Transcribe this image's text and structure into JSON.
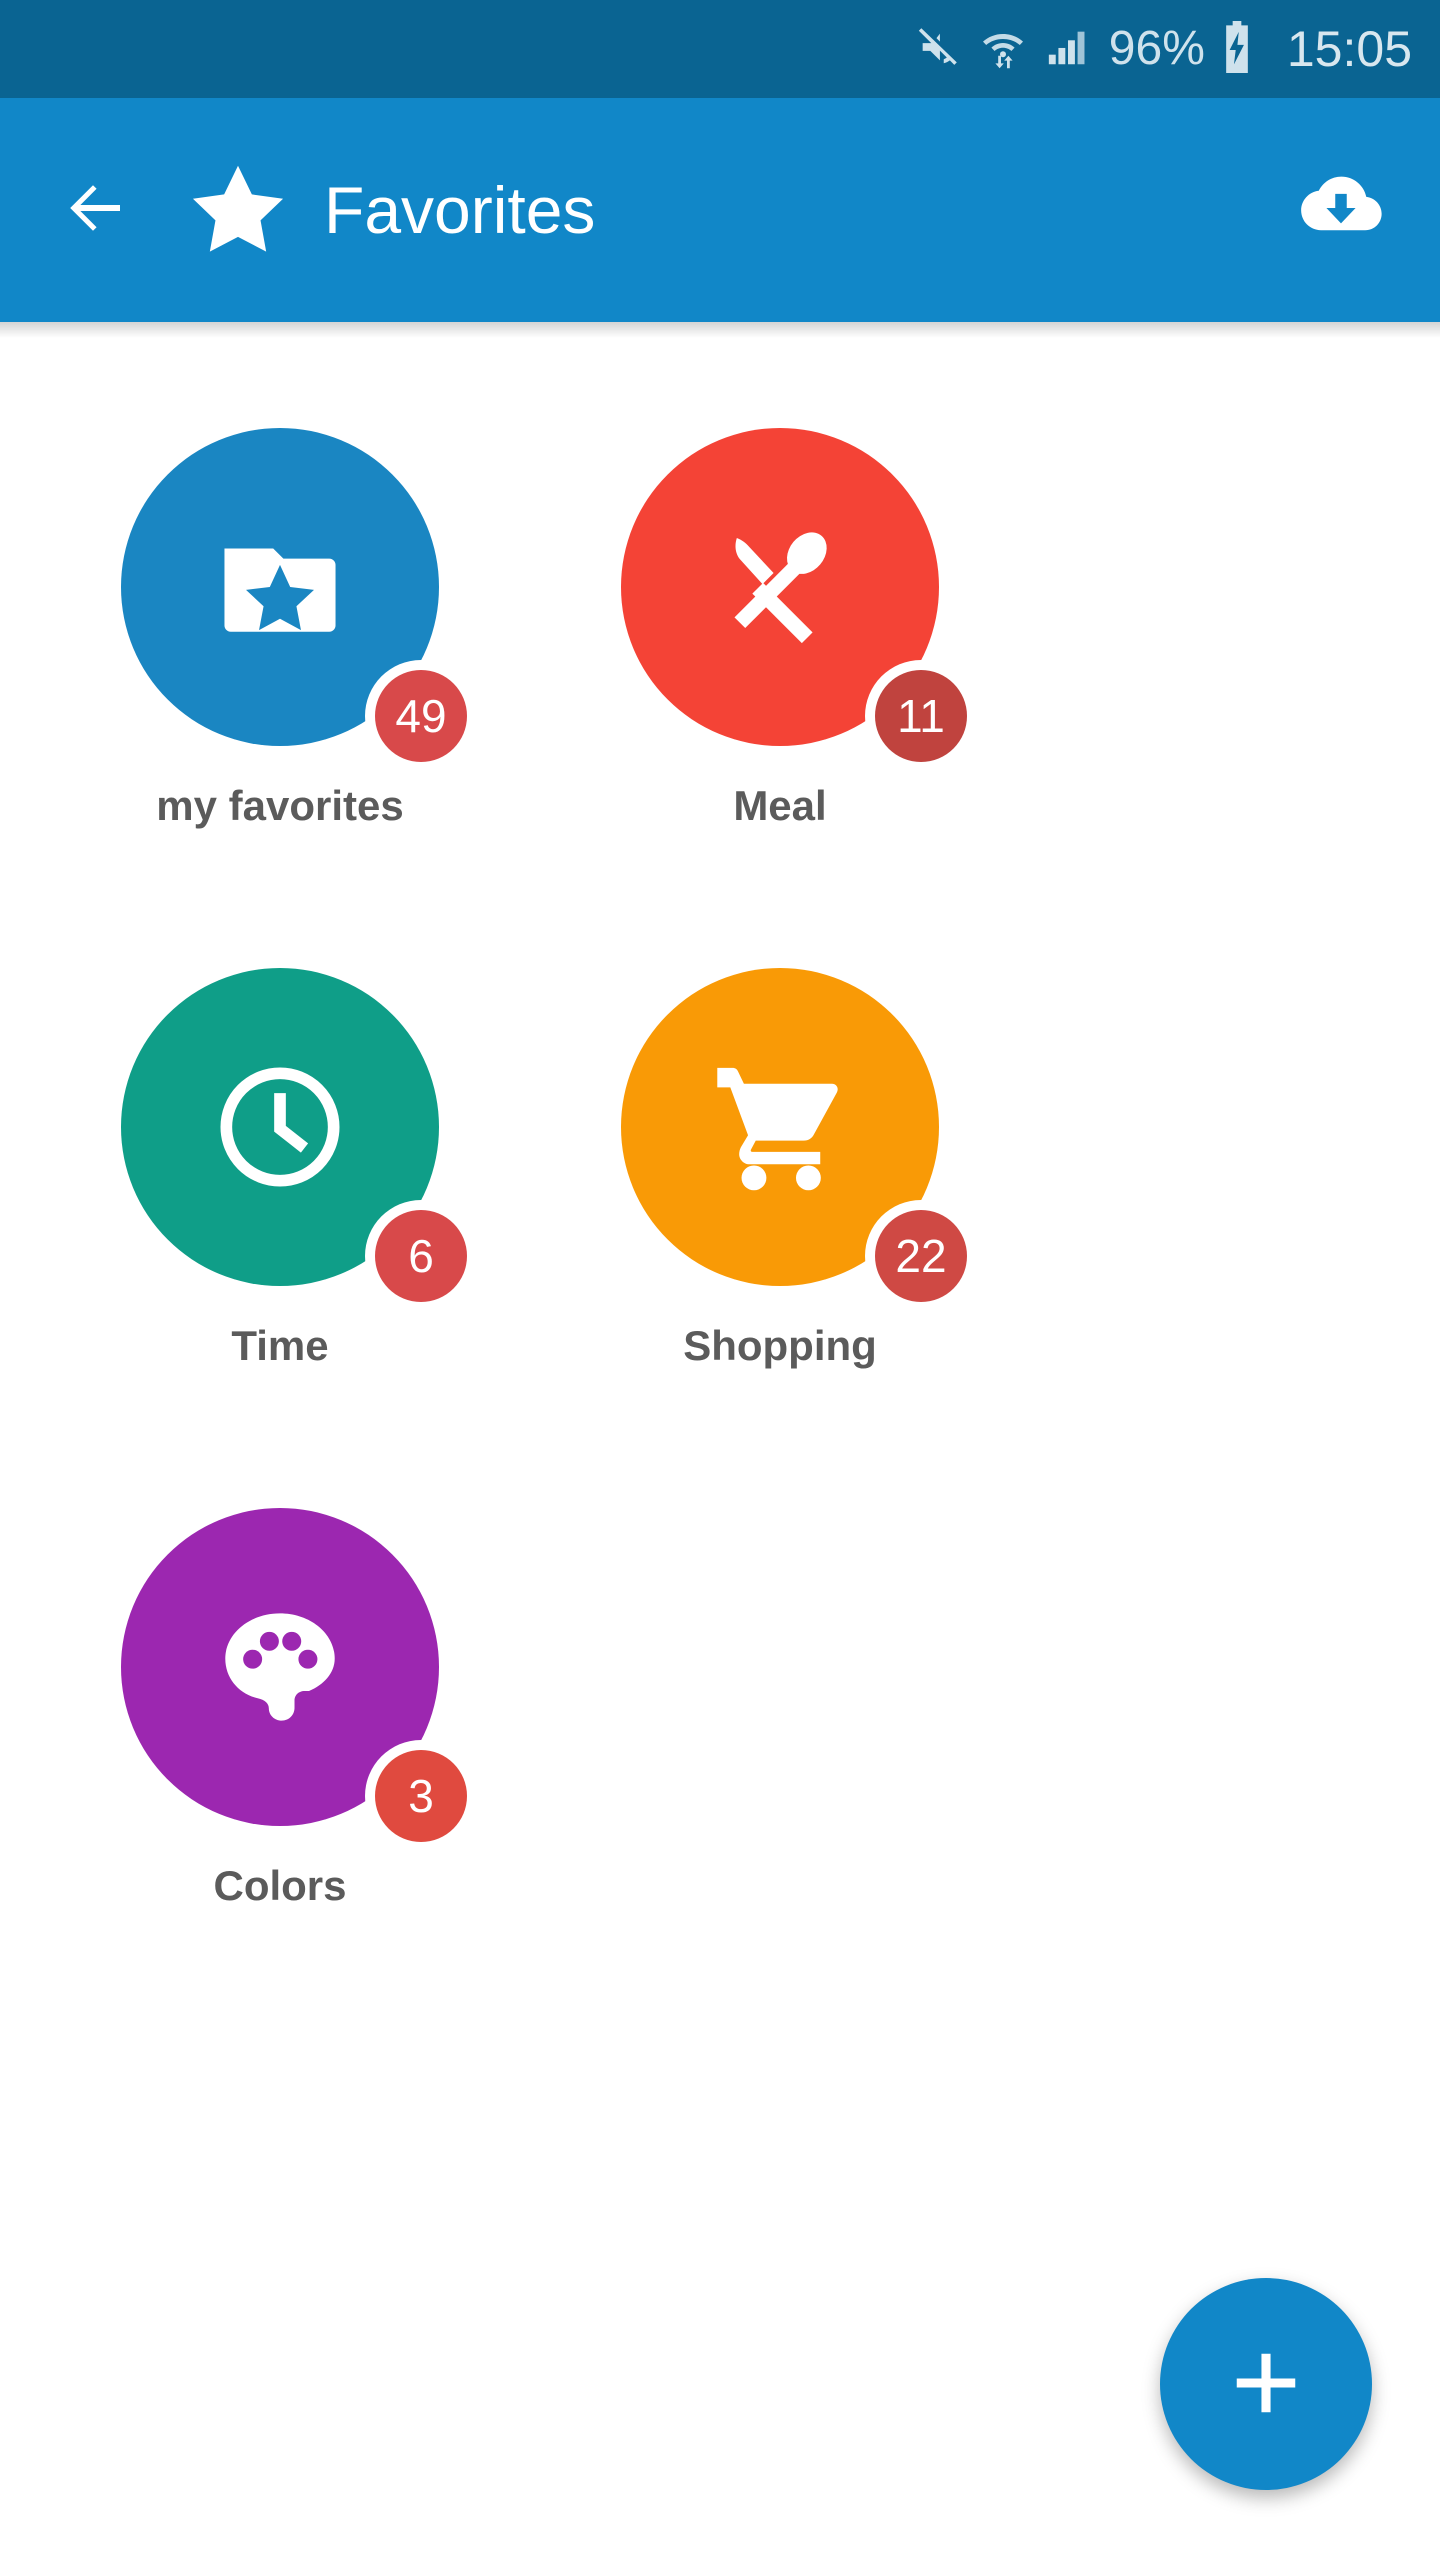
{
  "status_bar": {
    "background_color": "#0a6492",
    "text_color": "#cfe2ec",
    "mute_icon": "mute-icon",
    "wifi_icon": "wifi-transfer-icon",
    "signal_icon": "signal-bars-icon",
    "battery_percent": "96%",
    "battery_icon": "battery-charging-icon",
    "clock": "15:05"
  },
  "app_bar": {
    "background_color": "#1187c8",
    "back_icon": "back-arrow-icon",
    "star_icon": "star-icon",
    "title": "Favorites",
    "action_icon": "cloud-download-icon"
  },
  "grid": {
    "tiles": [
      {
        "label": "my favorites",
        "badge": "49",
        "color": "#1a86c2",
        "badge_color": "#d8494a",
        "icon": "folder-star-icon"
      },
      {
        "label": "Meal",
        "badge": "11",
        "color": "#f44336",
        "badge_color": "#c0433e",
        "icon": "knife-spoon-icon"
      },
      {
        "label": "Time",
        "badge": "6",
        "color": "#0f9e88",
        "badge_color": "#d8494a",
        "icon": "clock-icon"
      },
      {
        "label": "Shopping",
        "badge": "22",
        "color": "#f99a06",
        "badge_color": "#cf4944",
        "icon": "shopping-cart-icon"
      },
      {
        "label": "Colors",
        "badge": "3",
        "color": "#9c27b0",
        "badge_color": "#e04a3f",
        "icon": "palette-icon"
      }
    ],
    "label_color": "#5b5b5b"
  },
  "fab": {
    "icon": "plus-icon",
    "color": "#1187c8"
  }
}
